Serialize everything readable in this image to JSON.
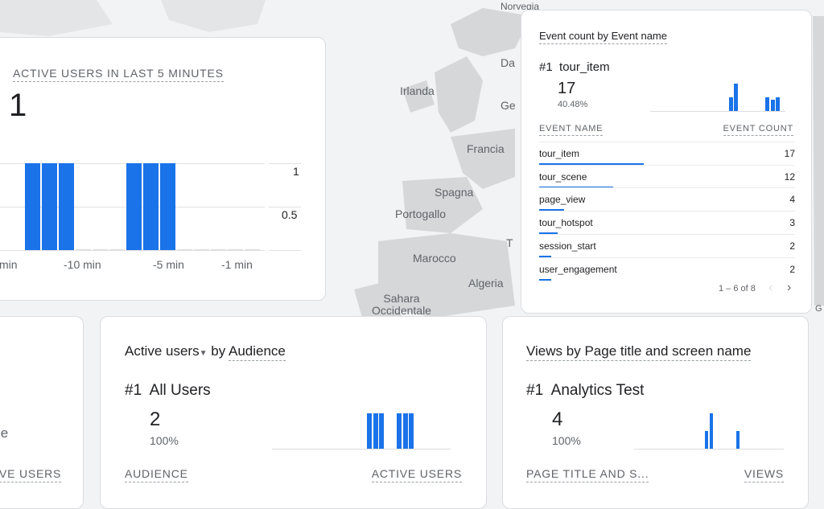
{
  "map": {
    "labels": [
      "Norvegia",
      "Irlanda",
      "Francia",
      "Spagna",
      "Portogallo",
      "Marocco",
      "Algeria",
      "Sahara Occidentale",
      "Da",
      "Ge",
      "T",
      "G"
    ]
  },
  "active_5min": {
    "title": "ACTIVE USERS IN LAST 5 MINUTES",
    "value": "1",
    "y_labels": [
      "1",
      "0.5"
    ],
    "x_labels": [
      "min",
      "-10 min",
      "-5 min",
      "-1 min"
    ],
    "chart_data": {
      "type": "bar",
      "title": "",
      "y_ticks": [
        1,
        0.5
      ],
      "ylim": [
        0,
        1
      ],
      "x_tick_labels": [
        "min",
        "-10 min",
        "-5 min",
        "-1 min"
      ],
      "values": [
        1,
        1,
        1,
        0,
        0,
        0,
        1,
        1,
        1,
        0,
        0,
        0,
        0,
        0
      ]
    }
  },
  "event_count": {
    "title": "Event count by Event name",
    "rank": "#1",
    "top_name": "tour_item",
    "top_value": "17",
    "top_pct": "40.48%",
    "col_name": "EVENT NAME",
    "col_count": "EVENT COUNT",
    "rows": [
      {
        "name": "tour_item",
        "count": "17",
        "share": 1.0
      },
      {
        "name": "tour_scene",
        "count": "12",
        "share": 0.706
      },
      {
        "name": "page_view",
        "count": "4",
        "share": 0.235
      },
      {
        "name": "tour_hotspot",
        "count": "3",
        "share": 0.176
      },
      {
        "name": "session_start",
        "count": "2",
        "share": 0.118
      },
      {
        "name": "user_engagement",
        "count": "2",
        "share": 0.118
      }
    ],
    "pagination": "1 – 6 of 8",
    "sparkline": {
      "type": "bar",
      "values": [
        0,
        0,
        0,
        0,
        0,
        0,
        0,
        0,
        0,
        0,
        0,
        0,
        0,
        0,
        0,
        0.5,
        1,
        0,
        0,
        0,
        0,
        0,
        0.5,
        0.4,
        0.5
      ]
    }
  },
  "left_card": {
    "text_le": "le",
    "col_label": "VE USERS"
  },
  "audience": {
    "title_metric": "Active users",
    "title_by": "by",
    "title_dim": "Audience",
    "rank": "#1",
    "top_name": "All Users",
    "top_value": "2",
    "top_pct": "100%",
    "col_name": "AUDIENCE",
    "col_value": "ACTIVE USERS",
    "sparkline": {
      "type": "bar",
      "values": [
        0,
        0,
        0,
        0,
        0,
        0,
        0,
        0,
        0,
        0,
        0,
        0,
        0,
        0,
        0,
        0,
        1,
        1,
        1,
        0,
        0,
        1,
        1,
        1,
        0,
        0,
        0,
        0,
        0,
        0
      ]
    }
  },
  "views": {
    "title": "Views by Page title and screen name",
    "rank": "#1",
    "top_name": "Analytics Test",
    "top_value": "4",
    "top_pct": "100%",
    "col_name": "PAGE TITLE AND S...",
    "col_value": "VIEWS",
    "sparkline": {
      "type": "bar",
      "values": [
        0,
        0,
        0,
        0,
        0,
        0,
        0,
        0,
        0,
        0,
        0,
        0,
        0,
        0,
        0,
        0,
        0.5,
        1,
        0,
        0,
        0,
        0,
        0,
        0.5,
        0,
        0,
        0,
        0,
        0,
        0
      ]
    }
  }
}
